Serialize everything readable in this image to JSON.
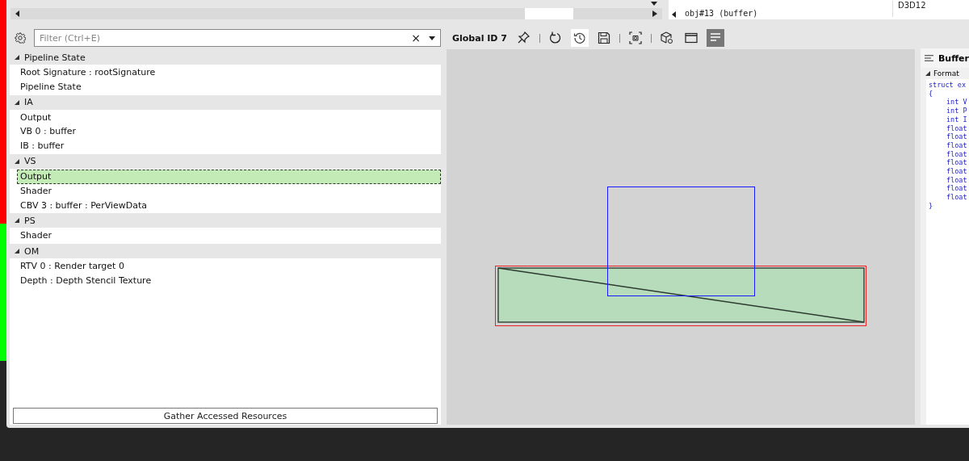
{
  "top_panel": {
    "tree_item": "obj#13 (buffer)",
    "column_text": "D3D12"
  },
  "filter": {
    "placeholder": "Filter (Ctrl+E)",
    "clear": "×"
  },
  "tree": [
    {
      "label": "Pipeline State",
      "expanded": true,
      "children": [
        {
          "label": "Root Signature : rootSignature",
          "selected": false
        },
        {
          "label": "Pipeline State",
          "selected": false
        }
      ]
    },
    {
      "label": "IA",
      "expanded": true,
      "children": [
        {
          "label": "Output",
          "selected": false
        },
        {
          "label": "VB 0 : buffer",
          "selected": false
        },
        {
          "label": "IB : buffer",
          "selected": false
        }
      ]
    },
    {
      "label": "VS",
      "expanded": true,
      "children": [
        {
          "label": "Output",
          "selected": true
        },
        {
          "label": "Shader",
          "selected": false
        },
        {
          "label": "CBV 3 : buffer : PerViewData",
          "selected": false
        }
      ]
    },
    {
      "label": "PS",
      "expanded": true,
      "children": [
        {
          "label": "Shader",
          "selected": false
        }
      ]
    },
    {
      "label": "OM",
      "expanded": true,
      "children": [
        {
          "label": "RTV 0 : Render target 0",
          "selected": false
        },
        {
          "label": "Depth : Depth Stencil Texture",
          "selected": false
        }
      ]
    }
  ],
  "gather_button": "Gather Accessed Resources",
  "toolbar": {
    "title": "Global ID 7",
    "buttons": [
      {
        "kind": "pin",
        "on": false,
        "hovered": false
      },
      {
        "kind": "sep"
      },
      {
        "kind": "refresh",
        "on": false,
        "hovered": false
      },
      {
        "kind": "history",
        "on": false,
        "hovered": true
      },
      {
        "kind": "save",
        "on": false,
        "hovered": false
      },
      {
        "kind": "sep"
      },
      {
        "kind": "capture",
        "on": false,
        "hovered": false
      },
      {
        "kind": "sep"
      },
      {
        "kind": "cube",
        "on": false,
        "hovered": false
      },
      {
        "kind": "window",
        "on": false,
        "hovered": false
      },
      {
        "kind": "lines",
        "on": true,
        "hovered": false
      }
    ]
  },
  "buffer_panel": {
    "title": "Buffer",
    "section": "Format",
    "expanded": true,
    "code": [
      {
        "text": "struct ex",
        "indent": false
      },
      {
        "text": "{",
        "indent": false
      },
      {
        "text": "int V",
        "indent": true
      },
      {
        "text": "int P",
        "indent": true
      },
      {
        "text": "int I",
        "indent": true
      },
      {
        "text": "float",
        "indent": true
      },
      {
        "text": "float",
        "indent": true
      },
      {
        "text": "float",
        "indent": true
      },
      {
        "text": "float",
        "indent": true
      },
      {
        "text": "float",
        "indent": true
      },
      {
        "text": "float",
        "indent": true
      },
      {
        "text": "float",
        "indent": true
      },
      {
        "text": "float",
        "indent": true
      },
      {
        "text": "float",
        "indent": true
      },
      {
        "text": "}",
        "indent": false
      }
    ]
  }
}
